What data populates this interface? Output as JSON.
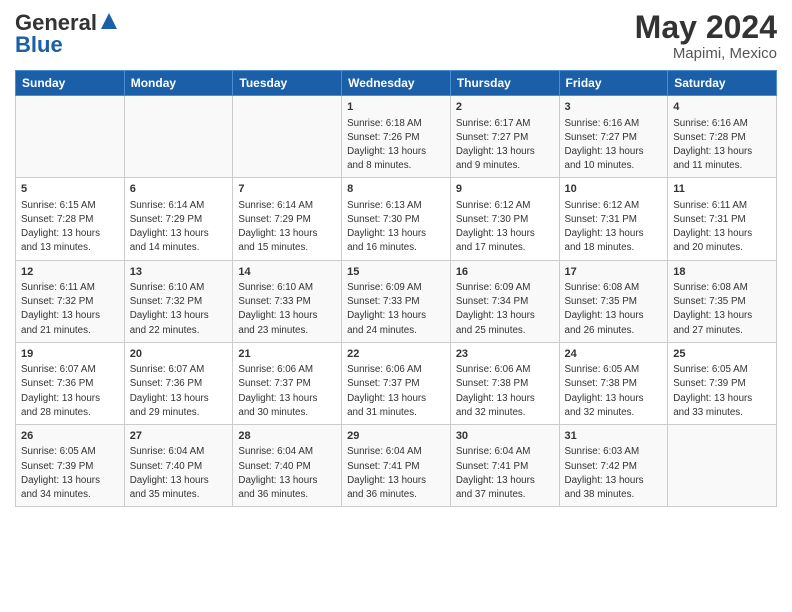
{
  "header": {
    "logo_line1": "General",
    "logo_line2": "Blue",
    "main_title": "May 2024",
    "sub_title": "Mapimi, Mexico"
  },
  "days_of_week": [
    "Sunday",
    "Monday",
    "Tuesday",
    "Wednesday",
    "Thursday",
    "Friday",
    "Saturday"
  ],
  "weeks": [
    [
      {
        "num": "",
        "info": ""
      },
      {
        "num": "",
        "info": ""
      },
      {
        "num": "",
        "info": ""
      },
      {
        "num": "1",
        "info": "Sunrise: 6:18 AM\nSunset: 7:26 PM\nDaylight: 13 hours\nand 8 minutes."
      },
      {
        "num": "2",
        "info": "Sunrise: 6:17 AM\nSunset: 7:27 PM\nDaylight: 13 hours\nand 9 minutes."
      },
      {
        "num": "3",
        "info": "Sunrise: 6:16 AM\nSunset: 7:27 PM\nDaylight: 13 hours\nand 10 minutes."
      },
      {
        "num": "4",
        "info": "Sunrise: 6:16 AM\nSunset: 7:28 PM\nDaylight: 13 hours\nand 11 minutes."
      }
    ],
    [
      {
        "num": "5",
        "info": "Sunrise: 6:15 AM\nSunset: 7:28 PM\nDaylight: 13 hours\nand 13 minutes."
      },
      {
        "num": "6",
        "info": "Sunrise: 6:14 AM\nSunset: 7:29 PM\nDaylight: 13 hours\nand 14 minutes."
      },
      {
        "num": "7",
        "info": "Sunrise: 6:14 AM\nSunset: 7:29 PM\nDaylight: 13 hours\nand 15 minutes."
      },
      {
        "num": "8",
        "info": "Sunrise: 6:13 AM\nSunset: 7:30 PM\nDaylight: 13 hours\nand 16 minutes."
      },
      {
        "num": "9",
        "info": "Sunrise: 6:12 AM\nSunset: 7:30 PM\nDaylight: 13 hours\nand 17 minutes."
      },
      {
        "num": "10",
        "info": "Sunrise: 6:12 AM\nSunset: 7:31 PM\nDaylight: 13 hours\nand 18 minutes."
      },
      {
        "num": "11",
        "info": "Sunrise: 6:11 AM\nSunset: 7:31 PM\nDaylight: 13 hours\nand 20 minutes."
      }
    ],
    [
      {
        "num": "12",
        "info": "Sunrise: 6:11 AM\nSunset: 7:32 PM\nDaylight: 13 hours\nand 21 minutes."
      },
      {
        "num": "13",
        "info": "Sunrise: 6:10 AM\nSunset: 7:32 PM\nDaylight: 13 hours\nand 22 minutes."
      },
      {
        "num": "14",
        "info": "Sunrise: 6:10 AM\nSunset: 7:33 PM\nDaylight: 13 hours\nand 23 minutes."
      },
      {
        "num": "15",
        "info": "Sunrise: 6:09 AM\nSunset: 7:33 PM\nDaylight: 13 hours\nand 24 minutes."
      },
      {
        "num": "16",
        "info": "Sunrise: 6:09 AM\nSunset: 7:34 PM\nDaylight: 13 hours\nand 25 minutes."
      },
      {
        "num": "17",
        "info": "Sunrise: 6:08 AM\nSunset: 7:35 PM\nDaylight: 13 hours\nand 26 minutes."
      },
      {
        "num": "18",
        "info": "Sunrise: 6:08 AM\nSunset: 7:35 PM\nDaylight: 13 hours\nand 27 minutes."
      }
    ],
    [
      {
        "num": "19",
        "info": "Sunrise: 6:07 AM\nSunset: 7:36 PM\nDaylight: 13 hours\nand 28 minutes."
      },
      {
        "num": "20",
        "info": "Sunrise: 6:07 AM\nSunset: 7:36 PM\nDaylight: 13 hours\nand 29 minutes."
      },
      {
        "num": "21",
        "info": "Sunrise: 6:06 AM\nSunset: 7:37 PM\nDaylight: 13 hours\nand 30 minutes."
      },
      {
        "num": "22",
        "info": "Sunrise: 6:06 AM\nSunset: 7:37 PM\nDaylight: 13 hours\nand 31 minutes."
      },
      {
        "num": "23",
        "info": "Sunrise: 6:06 AM\nSunset: 7:38 PM\nDaylight: 13 hours\nand 32 minutes."
      },
      {
        "num": "24",
        "info": "Sunrise: 6:05 AM\nSunset: 7:38 PM\nDaylight: 13 hours\nand 32 minutes."
      },
      {
        "num": "25",
        "info": "Sunrise: 6:05 AM\nSunset: 7:39 PM\nDaylight: 13 hours\nand 33 minutes."
      }
    ],
    [
      {
        "num": "26",
        "info": "Sunrise: 6:05 AM\nSunset: 7:39 PM\nDaylight: 13 hours\nand 34 minutes."
      },
      {
        "num": "27",
        "info": "Sunrise: 6:04 AM\nSunset: 7:40 PM\nDaylight: 13 hours\nand 35 minutes."
      },
      {
        "num": "28",
        "info": "Sunrise: 6:04 AM\nSunset: 7:40 PM\nDaylight: 13 hours\nand 36 minutes."
      },
      {
        "num": "29",
        "info": "Sunrise: 6:04 AM\nSunset: 7:41 PM\nDaylight: 13 hours\nand 36 minutes."
      },
      {
        "num": "30",
        "info": "Sunrise: 6:04 AM\nSunset: 7:41 PM\nDaylight: 13 hours\nand 37 minutes."
      },
      {
        "num": "31",
        "info": "Sunrise: 6:03 AM\nSunset: 7:42 PM\nDaylight: 13 hours\nand 38 minutes."
      },
      {
        "num": "",
        "info": ""
      }
    ]
  ]
}
